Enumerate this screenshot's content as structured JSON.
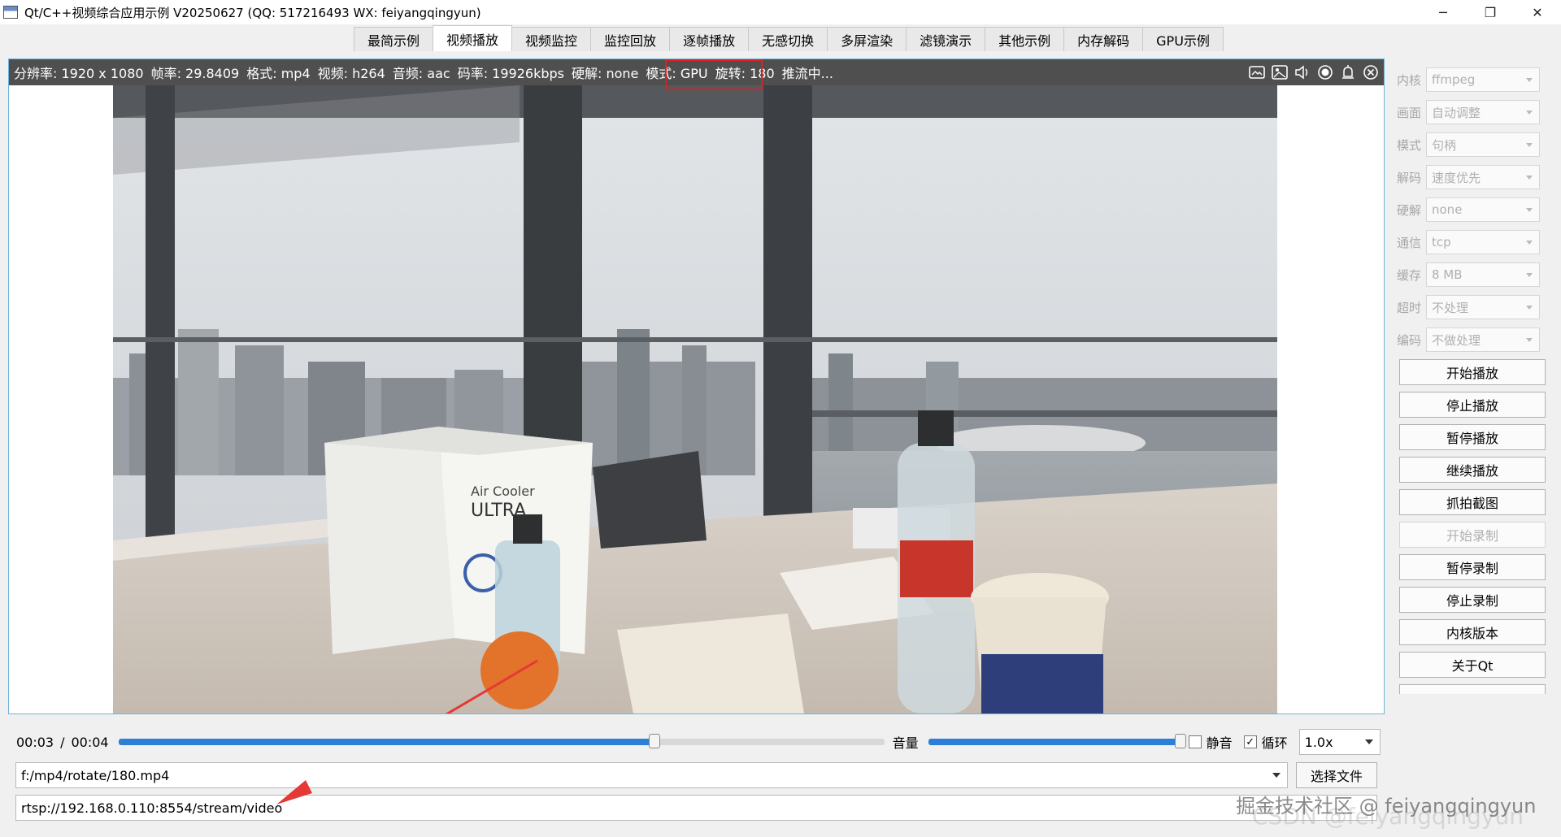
{
  "window": {
    "title": "Qt/C++视频综合应用示例 V20250627 (QQ: 517216493 WX: feiyangqingyun)",
    "minimize": "─",
    "maximize": "❐",
    "close": "✕"
  },
  "tabs": [
    {
      "label": "最简示例"
    },
    {
      "label": "视频播放",
      "active": true
    },
    {
      "label": "视频监控"
    },
    {
      "label": "监控回放"
    },
    {
      "label": "逐帧播放"
    },
    {
      "label": "无感切换"
    },
    {
      "label": "多屏渲染"
    },
    {
      "label": "滤镜演示"
    },
    {
      "label": "其他示例"
    },
    {
      "label": "内存解码"
    },
    {
      "label": "GPU示例"
    }
  ],
  "osd": {
    "resolution": "分辨率: 1920 x 1080",
    "fps": "帧率: 29.8409",
    "format": "格式: mp4",
    "video": "视频: h264",
    "audio": "音频: aac",
    "bitrate": "码率: 19926kbps",
    "hwdecode": "硬解: none",
    "mode": "模式: GPU",
    "rotate": "旋转: 180",
    "status": "推流中..."
  },
  "controls": {
    "current_time": "00:03",
    "separator": "/",
    "total_time": "00:04",
    "progress": 0.7,
    "volume_label": "音量",
    "volume": 1.0,
    "mute_label": "静音",
    "mute_checked": false,
    "loop_label": "循环",
    "loop_checked": true,
    "check_mark": "✓",
    "speed": "1.0x"
  },
  "file_path": "f:/mp4/rotate/180.mp4",
  "select_file_label": "选择文件",
  "stream_url": "rtsp://192.168.0.110:8554/stream/video",
  "panel": {
    "settings": [
      {
        "label": "内核",
        "value": "ffmpeg"
      },
      {
        "label": "画面",
        "value": "自动调整"
      },
      {
        "label": "模式",
        "value": "句柄"
      },
      {
        "label": "解码",
        "value": "速度优先"
      },
      {
        "label": "硬解",
        "value": "none"
      },
      {
        "label": "通信",
        "value": "tcp"
      },
      {
        "label": "缓存",
        "value": "8 MB"
      },
      {
        "label": "超时",
        "value": "不处理"
      },
      {
        "label": "编码",
        "value": "不做处理"
      }
    ],
    "buttons": [
      {
        "label": "开始播放",
        "enabled": true
      },
      {
        "label": "停止播放",
        "enabled": true
      },
      {
        "label": "暂停播放",
        "enabled": true
      },
      {
        "label": "继续播放",
        "enabled": true
      },
      {
        "label": "抓拍截图",
        "enabled": true
      },
      {
        "label": "开始录制",
        "enabled": false
      },
      {
        "label": "暂停录制",
        "enabled": true
      },
      {
        "label": "停止录制",
        "enabled": true
      },
      {
        "label": "内核版本",
        "enabled": true
      },
      {
        "label": "关于Qt",
        "enabled": true
      }
    ]
  },
  "watermark": "掘金技术社区 @ feiyangqingyun",
  "watermark2": "CSDN @feiyangqingyun",
  "colors": {
    "accent": "#2c7fd6",
    "highlight": "#e02020",
    "osd_bg": "#282828"
  }
}
